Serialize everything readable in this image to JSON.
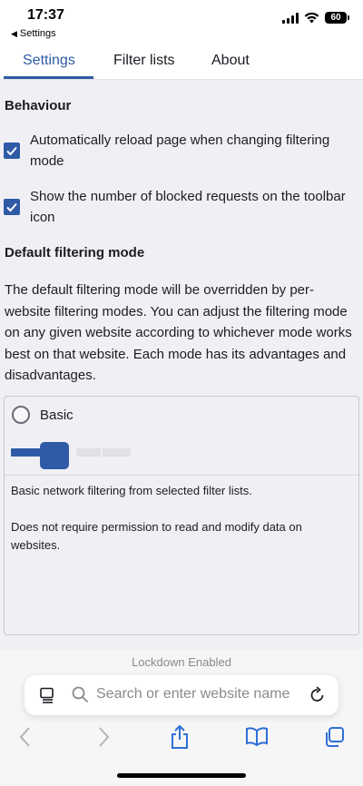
{
  "status": {
    "time": "17:37",
    "back_app_label": "Settings",
    "battery_level": "60"
  },
  "tabs": [
    {
      "label": "Settings",
      "active": true
    },
    {
      "label": "Filter lists",
      "active": false
    },
    {
      "label": "About",
      "active": false
    }
  ],
  "behaviour": {
    "heading": "Behaviour",
    "options": [
      {
        "label": "Automatically reload page when changing filtering mode",
        "checked": true
      },
      {
        "label": "Show the number of blocked requests on the toolbar icon",
        "checked": true
      }
    ]
  },
  "filtering": {
    "heading": "Default filtering mode",
    "description": "The default filtering mode will be overridden by per-website filtering modes. You can adjust the filtering mode on any given website according to whichever mode works best on that website. Each mode has its advantages and disadvantages.",
    "mode": {
      "name": "Basic",
      "selected": false,
      "level": 1,
      "levels": 4,
      "summary": "Basic network filtering from selected filter lists.",
      "permission_note": "Does not require permission to read and modify data on websites."
    }
  },
  "browser": {
    "lockdown_text": "Lockdown Enabled",
    "address_placeholder": "Search or enter website name"
  },
  "colors": {
    "accent": "#2f5ba6",
    "content_bg": "#f0f0f4",
    "text": "#1c1b22",
    "muted": "#8a8a8e"
  },
  "icons": [
    "wifi-icon",
    "signal-icon",
    "battery-icon",
    "checkmark-icon",
    "page-menu-icon",
    "search-icon",
    "reload-icon",
    "back-arrow-icon",
    "forward-arrow-icon",
    "share-icon",
    "bookmarks-icon",
    "tabs-icon"
  ]
}
